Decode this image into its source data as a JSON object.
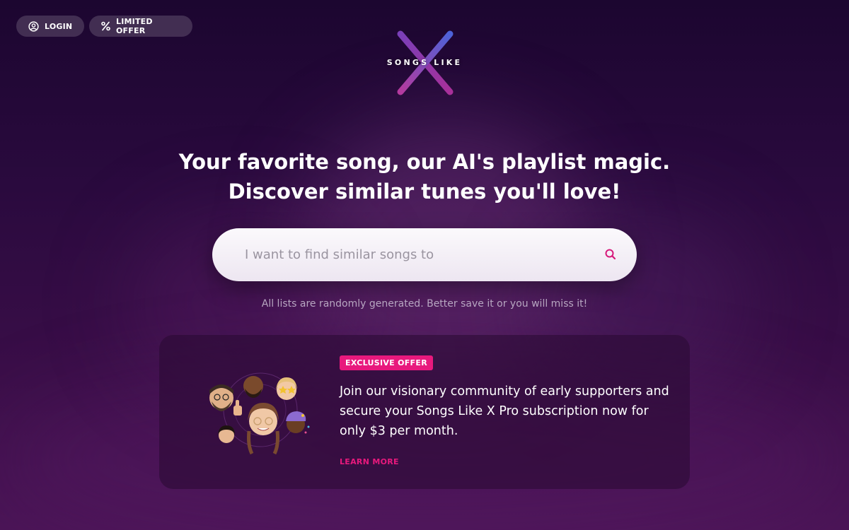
{
  "header": {
    "login_label": "LOGIN",
    "login_icon": "user-circle-icon",
    "offer_label": "LIMITED OFFER",
    "offer_icon": "percent-icon"
  },
  "logo": {
    "text": "SONGS LIKE",
    "mark": "X"
  },
  "hero": {
    "line1": "Your favorite song, our AI's playlist magic.",
    "line2": "Discover similar tunes you'll love!"
  },
  "search": {
    "placeholder": "I want to find similar songs to",
    "icon": "search-icon"
  },
  "note": "All lists are randomly generated. Better save it or you will miss it!",
  "promo": {
    "badge": "EXCLUSIVE OFFER",
    "text": "Join our visionary community of early supporters and secure your Songs Like X Pro subscription now for only $3 per month.",
    "link": "LEARN MORE",
    "image": "community-avatars"
  },
  "colors": {
    "accent": "#e8197d",
    "logo_x_start": "#a33fa8",
    "logo_x_end": "#5a4fd0"
  }
}
